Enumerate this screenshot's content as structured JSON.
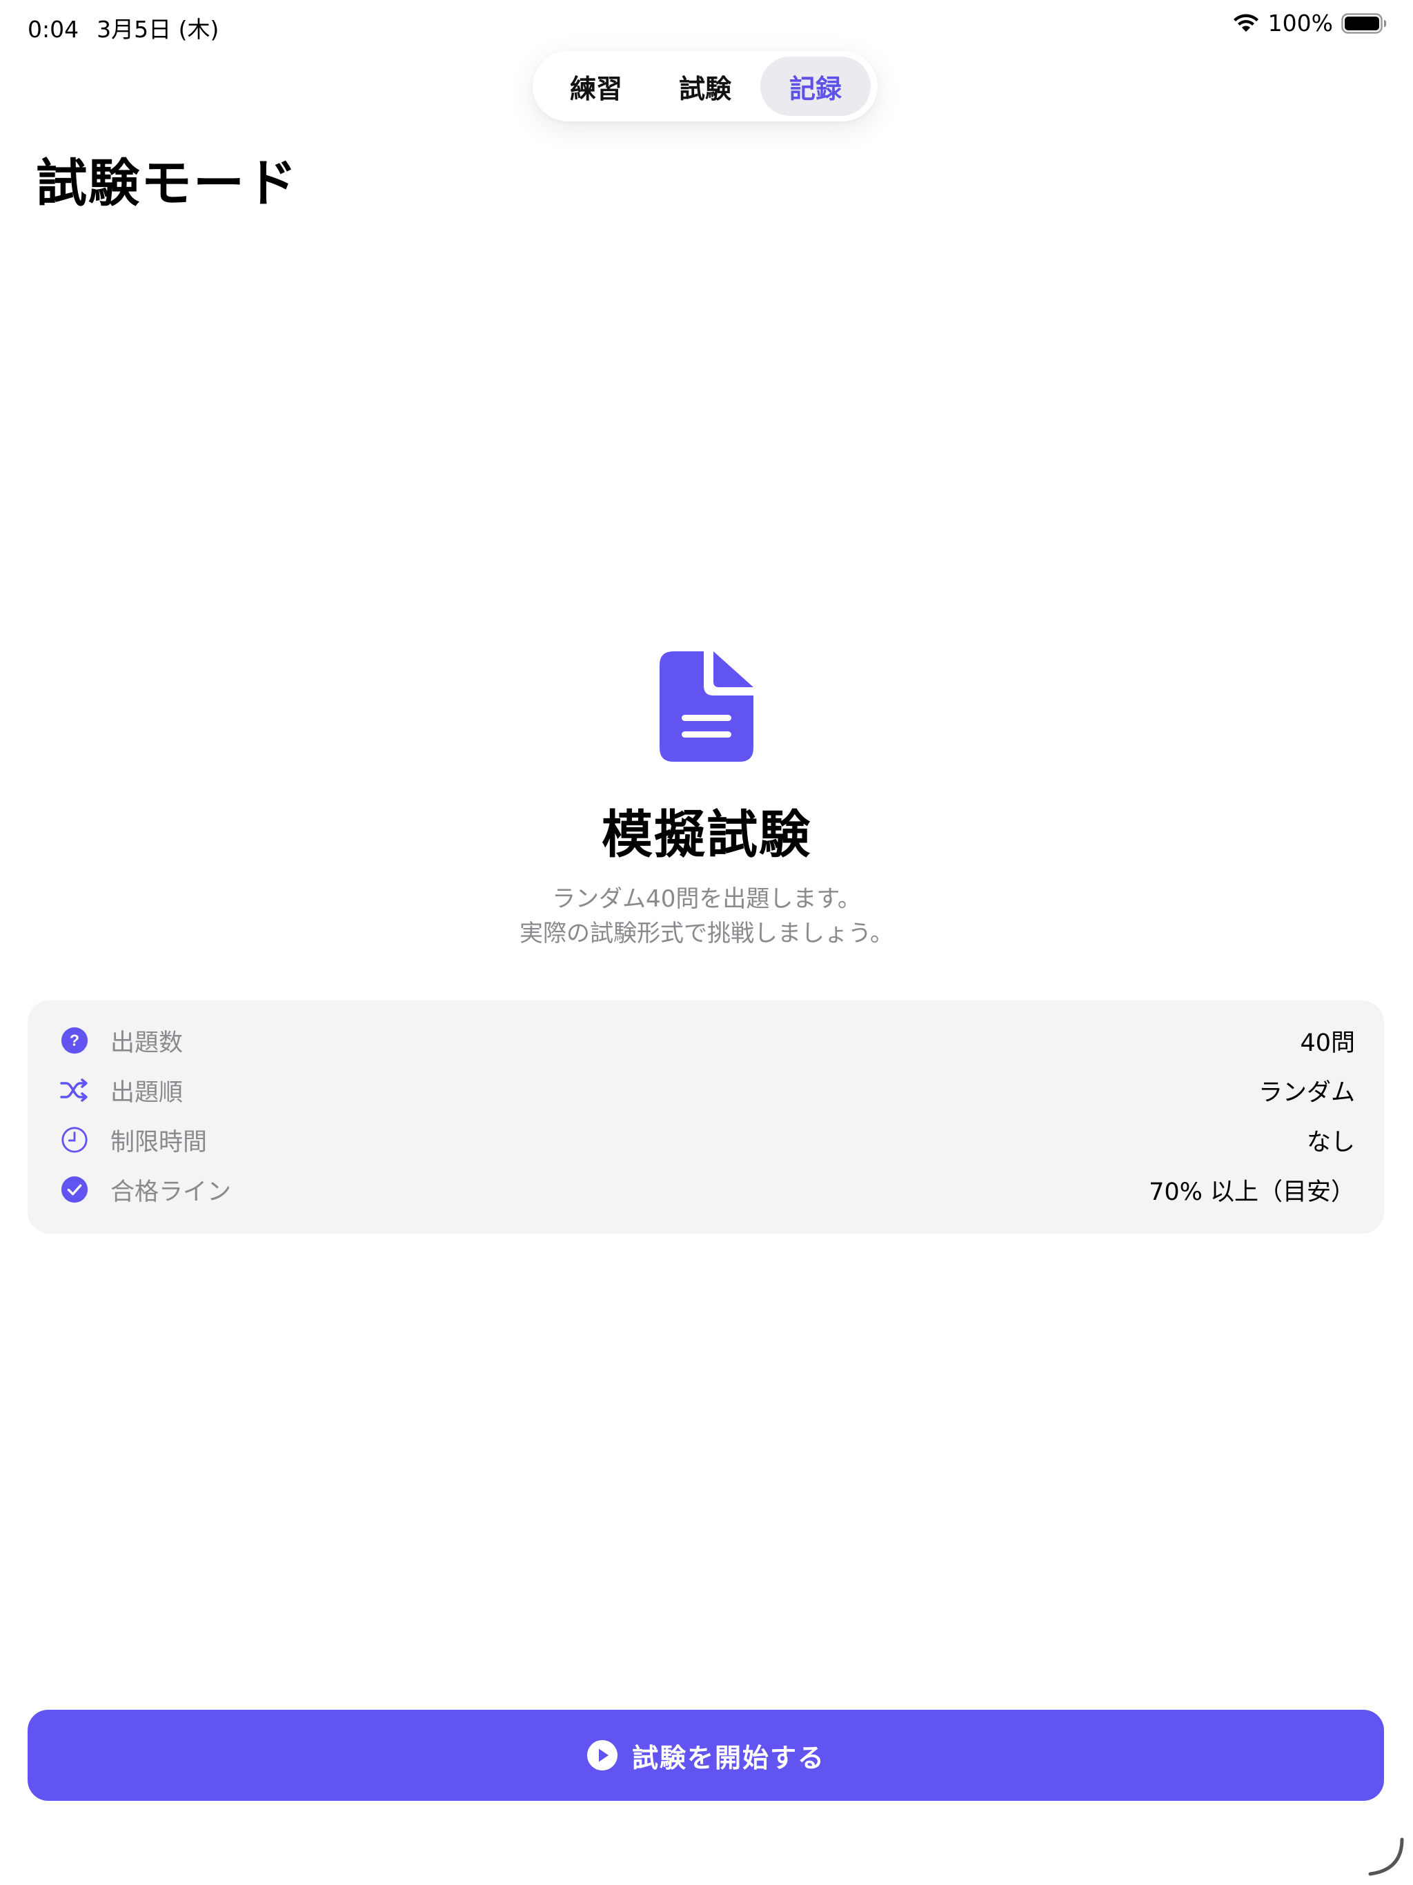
{
  "status_bar": {
    "time": "0:04",
    "date": "3月5日 (木)",
    "battery_percent": "100%",
    "wifi_icon": "wifi-icon",
    "battery_icon": "battery-full-icon"
  },
  "segment": {
    "items": [
      {
        "label": "練習",
        "selected": false
      },
      {
        "label": "試験",
        "selected": false
      },
      {
        "label": "記録",
        "selected": true
      }
    ],
    "selected_color": "#5e52e6"
  },
  "page": {
    "title": "試験モード"
  },
  "hero": {
    "icon": "document-icon",
    "title": "模擬試験",
    "description_line1": "ランダム40問を出題します。",
    "description_line2": "実際の試験形式で挑戦しましょう。"
  },
  "info": {
    "rows": [
      {
        "icon": "question-circle-icon",
        "label": "出題数",
        "value": "40問"
      },
      {
        "icon": "shuffle-icon",
        "label": "出題順",
        "value": "ランダム"
      },
      {
        "icon": "clock-icon",
        "label": "制限時間",
        "value": "なし"
      },
      {
        "icon": "checkmark-circle-icon",
        "label": "合格ライン",
        "value": "70% 以上（目安）"
      }
    ]
  },
  "start_button": {
    "label": "試験を開始する",
    "icon": "play-circle-icon",
    "color": "#6154f0"
  },
  "colors": {
    "accent": "#6154f0",
    "card_background": "#f4f4f5",
    "secondary_text": "#8a8a8e"
  }
}
